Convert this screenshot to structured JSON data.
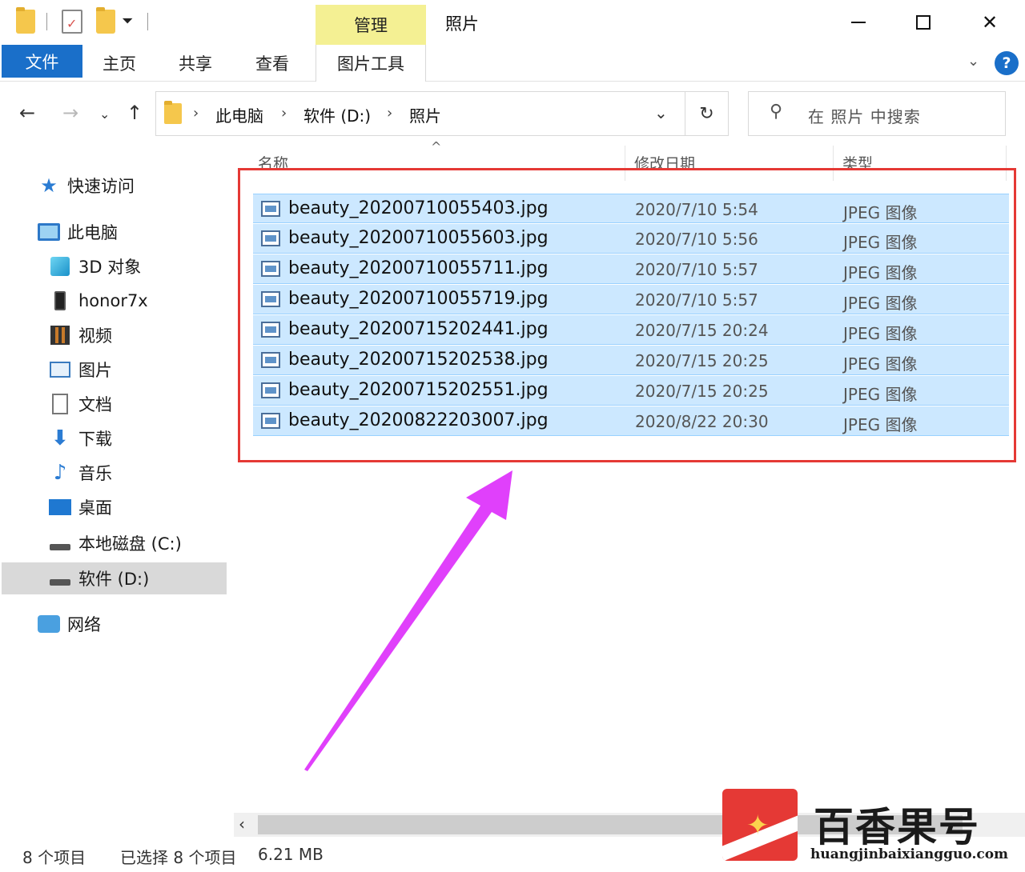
{
  "titlebar": {
    "manage_tab": "管理",
    "title": "照片",
    "minimize": "—",
    "maximize": "",
    "close": "✕"
  },
  "ribbon": {
    "file": "文件",
    "home": "主页",
    "share": "共享",
    "view": "查看",
    "picture_tools": "图片工具",
    "help": "?"
  },
  "address": {
    "crumbs": [
      "此电脑",
      "软件 (D:)",
      "照片"
    ],
    "separator": "›",
    "search_placeholder": "在 照片 中搜索"
  },
  "sidebar": {
    "items": [
      {
        "label": "快速访问",
        "icon": "star-icon"
      },
      {
        "label": "此电脑",
        "icon": "computer-icon"
      },
      {
        "label": "3D 对象",
        "icon": "cube-icon"
      },
      {
        "label": "honor7x",
        "icon": "phone-icon"
      },
      {
        "label": "视频",
        "icon": "video-icon"
      },
      {
        "label": "图片",
        "icon": "pictures-icon"
      },
      {
        "label": "文档",
        "icon": "document-icon"
      },
      {
        "label": "下载",
        "icon": "download-icon"
      },
      {
        "label": "音乐",
        "icon": "music-icon"
      },
      {
        "label": "桌面",
        "icon": "desktop-icon"
      },
      {
        "label": "本地磁盘 (C:)",
        "icon": "drive-icon"
      },
      {
        "label": "软件 (D:)",
        "icon": "drive-icon",
        "selected": true
      },
      {
        "label": "网络",
        "icon": "network-icon"
      }
    ]
  },
  "filelist": {
    "columns": [
      "名称",
      "修改日期",
      "类型"
    ],
    "rows": [
      {
        "name": "beauty_20200710055403.jpg",
        "date": "2020/7/10 5:54",
        "type": "JPEG 图像"
      },
      {
        "name": "beauty_20200710055603.jpg",
        "date": "2020/7/10 5:56",
        "type": "JPEG 图像"
      },
      {
        "name": "beauty_20200710055711.jpg",
        "date": "2020/7/10 5:57",
        "type": "JPEG 图像"
      },
      {
        "name": "beauty_20200710055719.jpg",
        "date": "2020/7/10 5:57",
        "type": "JPEG 图像"
      },
      {
        "name": "beauty_20200715202441.jpg",
        "date": "2020/7/15 20:24",
        "type": "JPEG 图像"
      },
      {
        "name": "beauty_20200715202538.jpg",
        "date": "2020/7/15 20:25",
        "type": "JPEG 图像"
      },
      {
        "name": "beauty_20200715202551.jpg",
        "date": "2020/7/15 20:25",
        "type": "JPEG 图像"
      },
      {
        "name": "beauty_20200822203007.jpg",
        "date": "2020/8/22 20:30",
        "type": "JPEG 图像"
      }
    ],
    "selection_color": "#cce8ff",
    "highlight_color": "#e53935",
    "arrow_color": "#e040fb"
  },
  "status": {
    "item_count": "8 个项目",
    "selected": "已选择 8 个项目",
    "size": "6.21 MB"
  },
  "watermark": {
    "title": "百香果号",
    "url": "huangjinbaixiangguo.com"
  }
}
